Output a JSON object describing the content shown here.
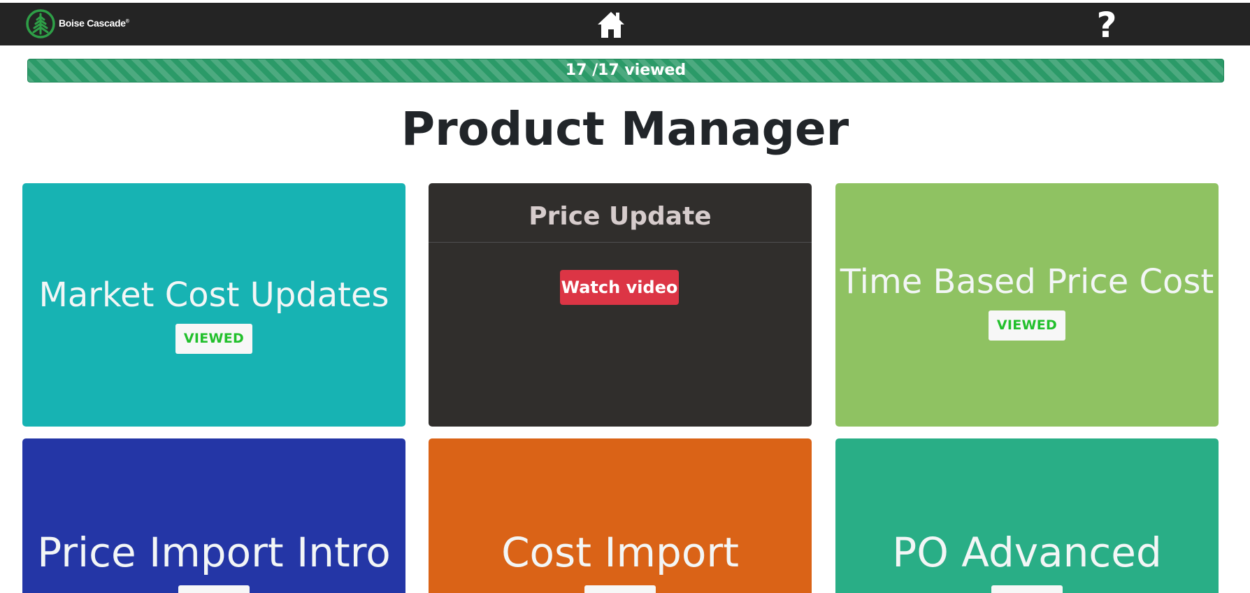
{
  "navbar": {
    "brand_name": "Boise Cascade",
    "brand_registered": "®",
    "home_icon": "home-icon",
    "help_icon": "help-icon",
    "help_glyph": "?"
  },
  "progress": {
    "label": "17 /17 viewed",
    "viewed": 17,
    "total": 17,
    "fraction": 1.0,
    "color": "#2b9a68"
  },
  "page": {
    "title": "Product Manager"
  },
  "cards": [
    {
      "title": "Market Cost Updates",
      "badge": "VIEWED",
      "color": "#17b3b3"
    },
    {
      "header": "Price Update",
      "button": "Watch video",
      "color": "#302e2c"
    },
    {
      "title": "Time Based Price Cost",
      "badge": "VIEWED",
      "color": "#8fc262"
    },
    {
      "title": "Price Import Intro",
      "color": "#2436a6"
    },
    {
      "title": "Cost Import",
      "color": "#da6317"
    },
    {
      "title": "PO Advanced",
      "color": "#29ae86"
    }
  ],
  "colors": {
    "navbar": "#242424",
    "title_text": "#212529",
    "viewed_text": "#22c02c",
    "watch_button": "#dc3545",
    "logo_green": "#2e9f47"
  }
}
